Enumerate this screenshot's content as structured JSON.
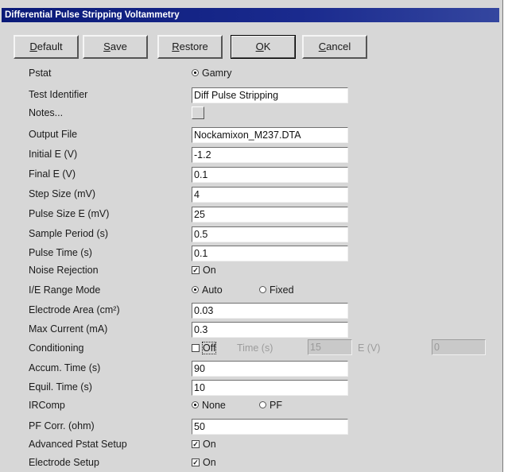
{
  "window": {
    "title": "Differential Pulse Stripping Voltammetry"
  },
  "buttons": [
    {
      "id": "default",
      "label": "Default",
      "underline": "D",
      "rest": "efault"
    },
    {
      "id": "save",
      "label": "Save",
      "underline": "S",
      "rest": "ave"
    },
    {
      "id": "restore",
      "label": "Restore",
      "underline": "R",
      "rest": "estore"
    },
    {
      "id": "ok",
      "label": "OK",
      "underline": "O",
      "rest": "K"
    },
    {
      "id": "cancel",
      "label": "Cancel",
      "underline": "C",
      "rest": "ancel"
    }
  ],
  "rows": {
    "pstat": {
      "label": "Pstat",
      "option": "Gamry"
    },
    "test_identifier": {
      "label": "Test Identifier",
      "value": "Diff Pulse Stripping"
    },
    "notes": {
      "label": "Notes..."
    },
    "output_file": {
      "label": "Output File",
      "value": "Nockamixon_M237.DTA"
    },
    "initial_e": {
      "label": "Initial E (V)",
      "value": "-1.2"
    },
    "final_e": {
      "label": "Final E (V)",
      "value": "0.1"
    },
    "step_size": {
      "label": "Step Size (mV)",
      "value": "4"
    },
    "pulse_size": {
      "label": "Pulse Size E (mV)",
      "value": "25"
    },
    "sample_period": {
      "label": "Sample Period (s)",
      "value": "0.5"
    },
    "pulse_time": {
      "label": "Pulse Time (s)",
      "value": "0.1"
    },
    "noise_rejection": {
      "label": "Noise Rejection",
      "check_label": "On",
      "checked": true
    },
    "ie_range_mode": {
      "label": "I/E Range Mode",
      "options": [
        "Auto",
        "Fixed"
      ],
      "selected": "Auto"
    },
    "electrode_area": {
      "label": "Electrode Area (cm²)",
      "value": "0.03"
    },
    "max_current": {
      "label": "Max Current (mA)",
      "value": "0.3"
    },
    "conditioning": {
      "label": "Conditioning",
      "check_label": "Off",
      "checked": false,
      "time_label": "Time (s)",
      "time_value": "15",
      "e_label": "E (V)",
      "e_value": "0"
    },
    "accum_time": {
      "label": "Accum. Time (s)",
      "value": "90"
    },
    "equil_time": {
      "label": "Equil. Time (s)",
      "value": "10"
    },
    "ircomp": {
      "label": "IRComp",
      "options": [
        "None",
        "PF"
      ],
      "selected": "None"
    },
    "pf_corr": {
      "label": "PF Corr. (ohm)",
      "value": "50"
    },
    "advanced_pstat": {
      "label": "Advanced Pstat Setup",
      "check_label": "On",
      "checked": true
    },
    "electrode_setup": {
      "label": "Electrode Setup",
      "check_label": "On",
      "checked": true
    }
  }
}
